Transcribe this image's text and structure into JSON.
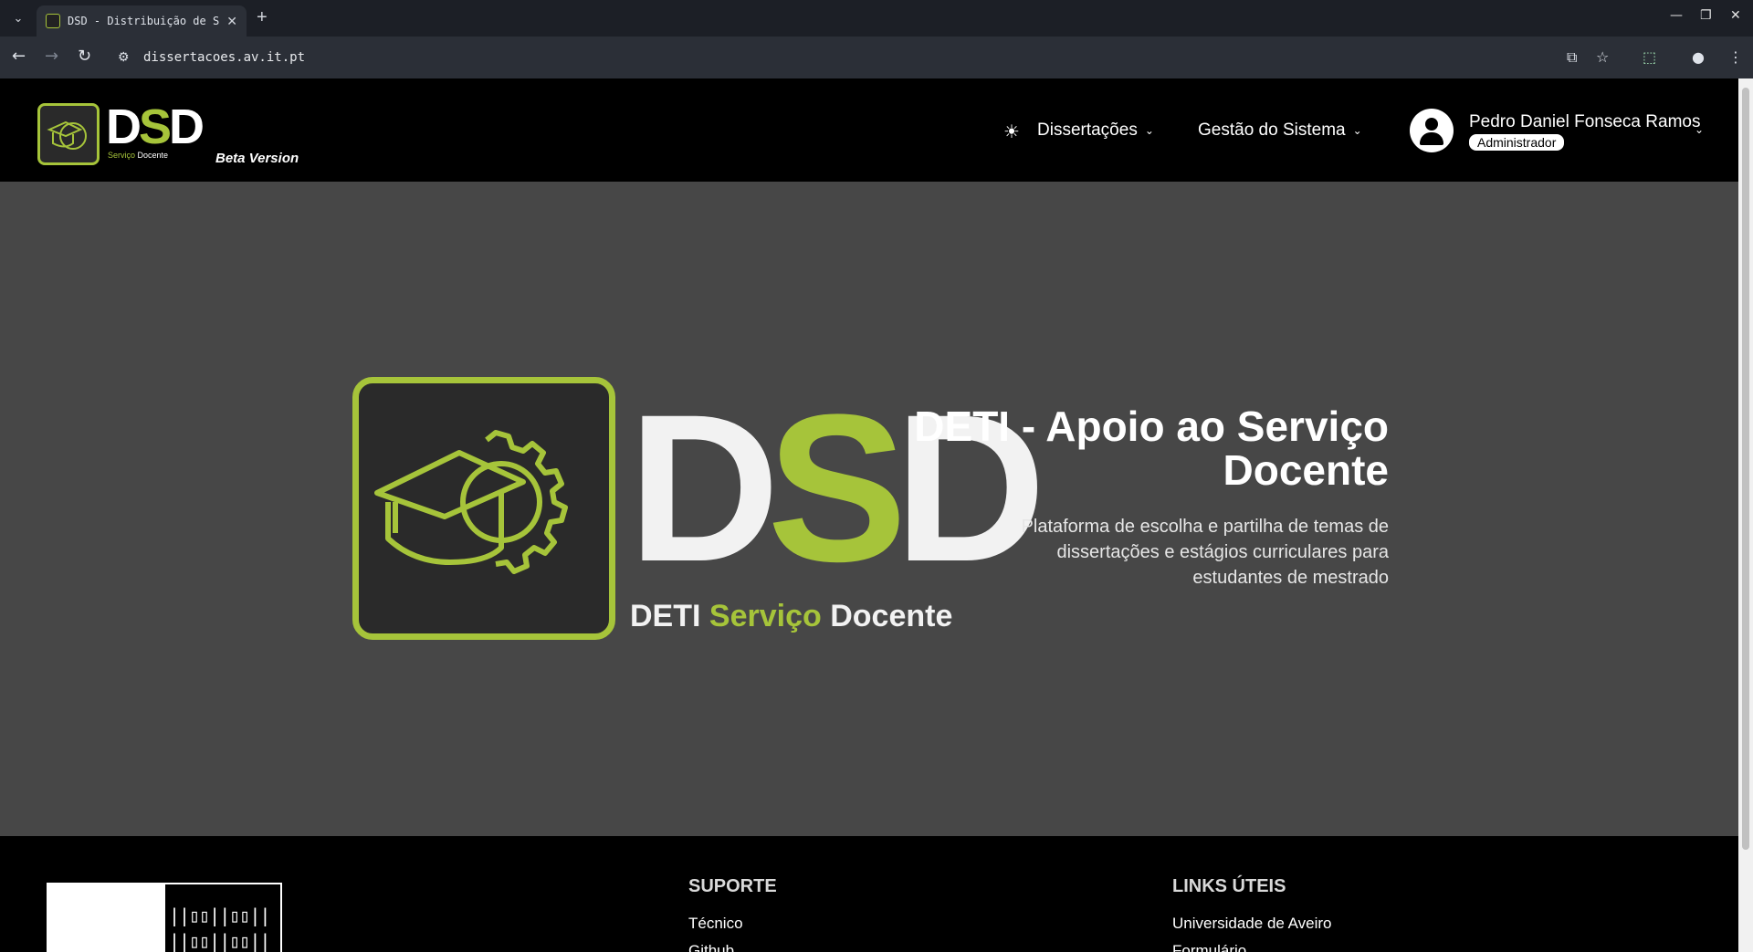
{
  "browser": {
    "tab_title": "DSD - Distribuição de S",
    "url": "dissertacoes.av.it.pt",
    "icons": [
      "tab-list-icon",
      "close-tab-icon",
      "new-tab-icon",
      "back-icon",
      "forward-icon",
      "reload-icon",
      "site-settings-icon",
      "translate-icon",
      "bookmark-star-icon",
      "extensions-icon",
      "profile-icon",
      "menu-icon",
      "minimize-icon",
      "restore-icon",
      "close-window-icon"
    ]
  },
  "header": {
    "logo_text_d1": "D",
    "logo_text_s": "S",
    "logo_text_d2": "D",
    "logo_sub_green": "Serviço",
    "logo_sub_white": "Docente",
    "beta": "Beta Version",
    "nav": [
      {
        "label": "Dissertações"
      },
      {
        "label": "Gestão do Sistema"
      }
    ],
    "user": {
      "name": "Pedro Daniel Fonseca Ramos",
      "role": "Administrador"
    }
  },
  "hero": {
    "logo_d1": "D",
    "logo_s": "S",
    "logo_d2": "D",
    "sub_1": "DETI ",
    "sub_2": "Serviço",
    "sub_3": " Docente",
    "title": "DETI - Apoio ao Serviço Docente",
    "description": "Plataforma de escolha e partilha de temas de dissertações e estágios curriculares para estudantes de mestrado"
  },
  "footer": {
    "support": {
      "heading": "SUPORTE",
      "links": [
        "Técnico",
        "Github"
      ]
    },
    "useful": {
      "heading": "LINKS ÚTEIS",
      "links": [
        "Universidade de Aveiro",
        "Formulário"
      ]
    }
  },
  "colors": {
    "accent": "#a6c43a",
    "header_bg": "#000000",
    "hero_bg": "#474747",
    "chrome_bg": "#2b2f37"
  }
}
